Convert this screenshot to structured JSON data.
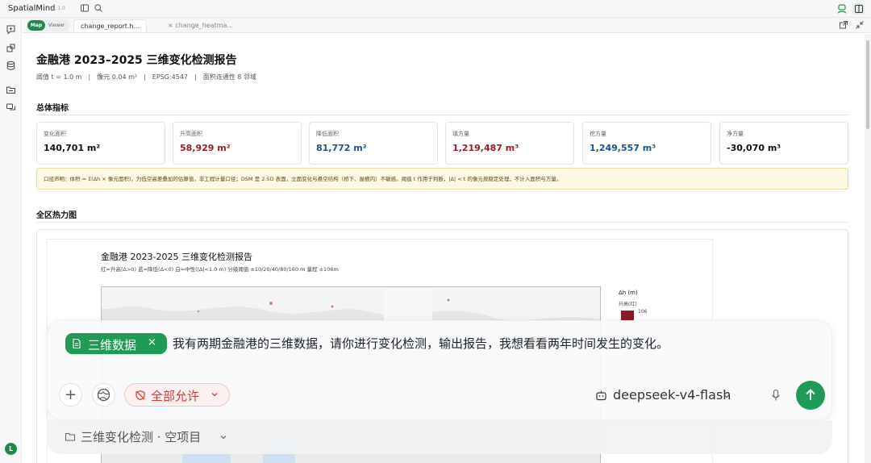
{
  "app": {
    "title": "SpatialMind",
    "version": "v1.1.0"
  },
  "tabs": {
    "mode_map": "Map",
    "mode_viewer": "Viewer",
    "active_tab": "change_report.h...",
    "inactive_tab": "× change_heatma..."
  },
  "report": {
    "title": "金融港 2023–2025 三维变化检测报告",
    "meta": "阈值 t = 1.0 m　|　像元 0.04 m²　|　EPSG:4547　|　面积连通性 8 邻域",
    "overview_title": "总体指标",
    "cards": [
      {
        "label": "变化面积",
        "value": "140,701 m²",
        "color": "#111111"
      },
      {
        "label": "升高面积",
        "value": "58,929 m²",
        "color": "#9b1b2c"
      },
      {
        "label": "降低面积",
        "value": "81,772 m²",
        "color": "#1d4f91"
      },
      {
        "label": "填方量",
        "value": "1,219,487 m³",
        "color": "#9b1b2c"
      },
      {
        "label": "挖方量",
        "value": "1,249,557 m³",
        "color": "#1d4f91"
      },
      {
        "label": "净方量",
        "value": "-30,070 m³",
        "color": "#111111"
      }
    ],
    "note": "口径声明：体积 = Σ(Δh × 像元面积)，为低空高差叠加的估算值，非工程计量口径；DSM 是 2.5D 表面，立面变化与悬空结构（桥下、屋檐内）不敏感。阈值 t 作用于判断，|Δ| < t 的像元按稳定处理，不计入面积与方量。",
    "heatmap_title": "全区热力图",
    "figure": {
      "title": "金融港 2023-2025 三维变化检测报告",
      "subtitle": "红=升高(Δ>0)  蓝=降低(Δ<0)  白=中性(|Δ|<1.0 m)  分级阈值 ±10/20/40/80/160 m  量程 ±106m",
      "legend_title": "Δh (m)",
      "legend_sub": "升高(红)",
      "legend_value": "106"
    }
  },
  "chat": {
    "chip_label": "三维数据",
    "chip_close": "×",
    "prompt": "我有两期金融港的三维数据，请你进行变化检测，输出报告，我想看看两年时间发生的变化。",
    "add_label": "+",
    "permission_label": "全部允许",
    "model_label": "deepseek-v4-flash",
    "project_label": "三维变化检测 · 空项目"
  },
  "user": {
    "avatar_initial": "L"
  },
  "colors": {
    "accent": "#1f9a57",
    "raise": "#9b1b2c",
    "lower": "#1d4f91"
  }
}
